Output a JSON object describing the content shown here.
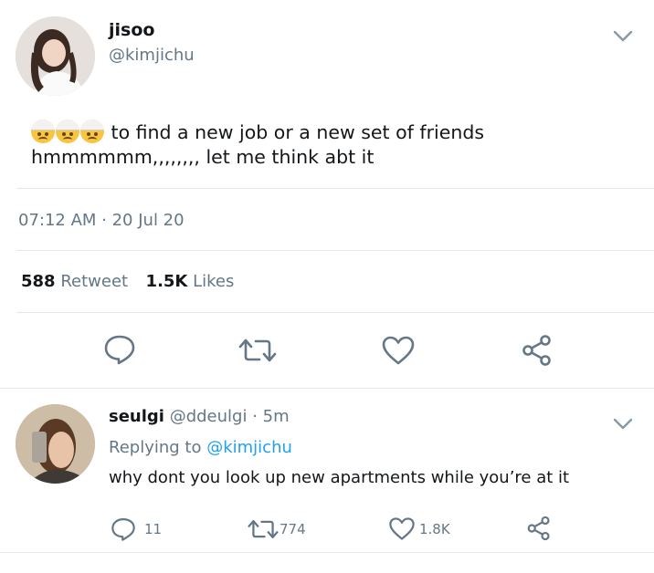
{
  "tweet": {
    "display_name": "jisoo",
    "handle": "@kimjichu",
    "emojis": [
      "face-with-head-bandage",
      "face-with-head-bandage",
      "face-with-head-bandage"
    ],
    "text_line1": "to find a new job or a new set of friends",
    "text_line2": "hmmmmmm,,,,,,,, let me think abt it",
    "timestamp": "07:12 AM · 20 Jul 20",
    "retweet_count": "588",
    "retweet_label": "Retweet",
    "like_count": "1.5K",
    "like_label": "Likes"
  },
  "reply": {
    "display_name": "seulgi",
    "handle": "@ddeulgi",
    "time": "· 5m",
    "replying_prefix": "Replying to",
    "replying_handle": "@kimjichu",
    "text": "why dont you look up new apartments while you’re at it",
    "reply_count": "11",
    "retweet_count": "774",
    "like_count": "1.8K"
  },
  "colors": {
    "text": "#14171a",
    "muted": "#657786",
    "link": "#1da1f2",
    "divider": "#e1e8ed",
    "icon": "#657786"
  }
}
